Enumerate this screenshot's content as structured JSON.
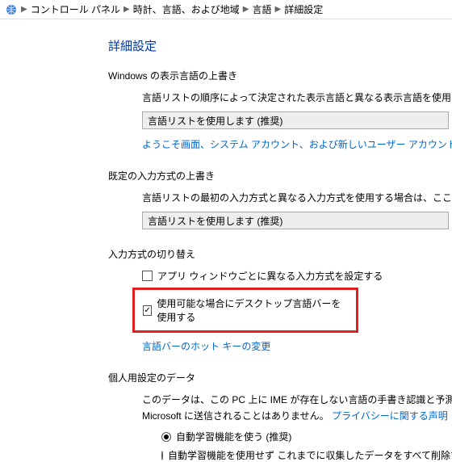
{
  "breadcrumb": {
    "items": [
      "コントロール パネル",
      "時計、言語、および地域",
      "言語",
      "詳細設定"
    ]
  },
  "title": "詳細設定",
  "section1": {
    "label": "Windows の表示言語の上書き",
    "desc": "言語リストの順序によって決定された表示言語と異なる表示言語を使用する場合",
    "select": "言語リストを使用します (推奨)",
    "link": "ようこそ画面、システム アカウント、および新しいユーザー アカウントに言語設定を適"
  },
  "section2": {
    "label": "既定の入力方式の上書き",
    "desc": "言語リストの最初の入力方式と異なる入力方式を使用する場合は、ここで選択し",
    "select": "言語リストを使用します (推奨)"
  },
  "section3": {
    "label": "入力方式の切り替え",
    "cb1": "アプリ ウィンドウごとに異なる入力方式を設定する",
    "cb2": "使用可能な場合にデスクトップ言語バーを使用する",
    "link": "言語バーのホット キーの変更"
  },
  "section4": {
    "label": "個人用設定のデータ",
    "desc1": "このデータは、この PC 上に IME が存在しない言語の手書き認識と予測入力の結",
    "desc2a": "Microsoft に送信されることはありません。",
    "desc2b": "プライバシーに関する声明",
    "radio1": "自動学習機能を使う (推奨)",
    "radio2": "自動学習機能を使用せず  これまでに収集したデータをすべて削除す"
  }
}
